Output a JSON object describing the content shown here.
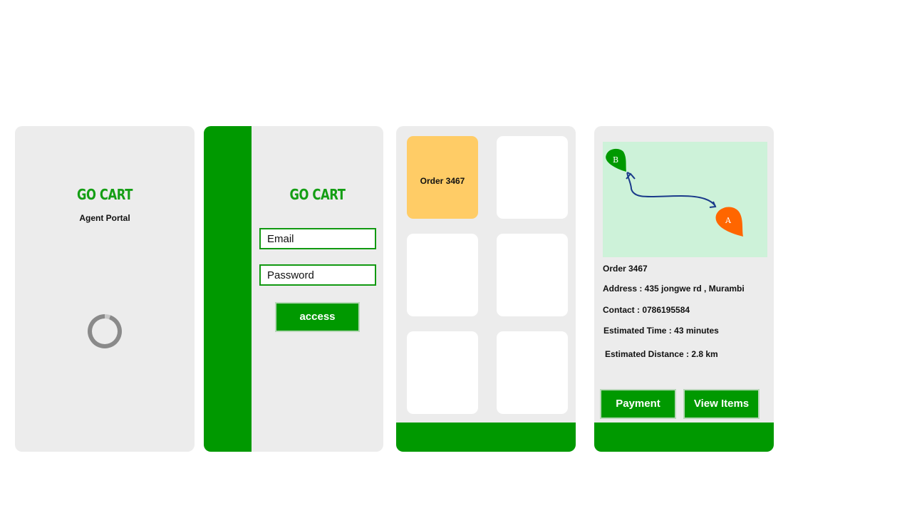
{
  "brand": {
    "name": "GO CART",
    "accent": "#009900"
  },
  "splash": {
    "subtitle": "Agent Portal",
    "loading_icon": "spinner-icon"
  },
  "login": {
    "email_placeholder": "Email",
    "password_placeholder": "Password",
    "access_label": "access"
  },
  "orders": {
    "cards": [
      {
        "label": "Order 3467",
        "highlight": true
      },
      {
        "label": ""
      },
      {
        "label": ""
      },
      {
        "label": ""
      },
      {
        "label": ""
      },
      {
        "label": ""
      }
    ],
    "highlight_color": "#ffcc66"
  },
  "detail": {
    "map": {
      "start_marker": "B",
      "end_marker": "A",
      "start_color": "#009900",
      "end_color": "#ff6600"
    },
    "order": "Order 3467",
    "address": "Address : 435 jongwe rd , Murambi",
    "contact": "Contact : 0786195584",
    "time": "Estimated Time : 43 minutes",
    "distance": "Estimated Distance : 2.8 km",
    "payment_label": "Payment",
    "view_items_label": "View Items"
  }
}
